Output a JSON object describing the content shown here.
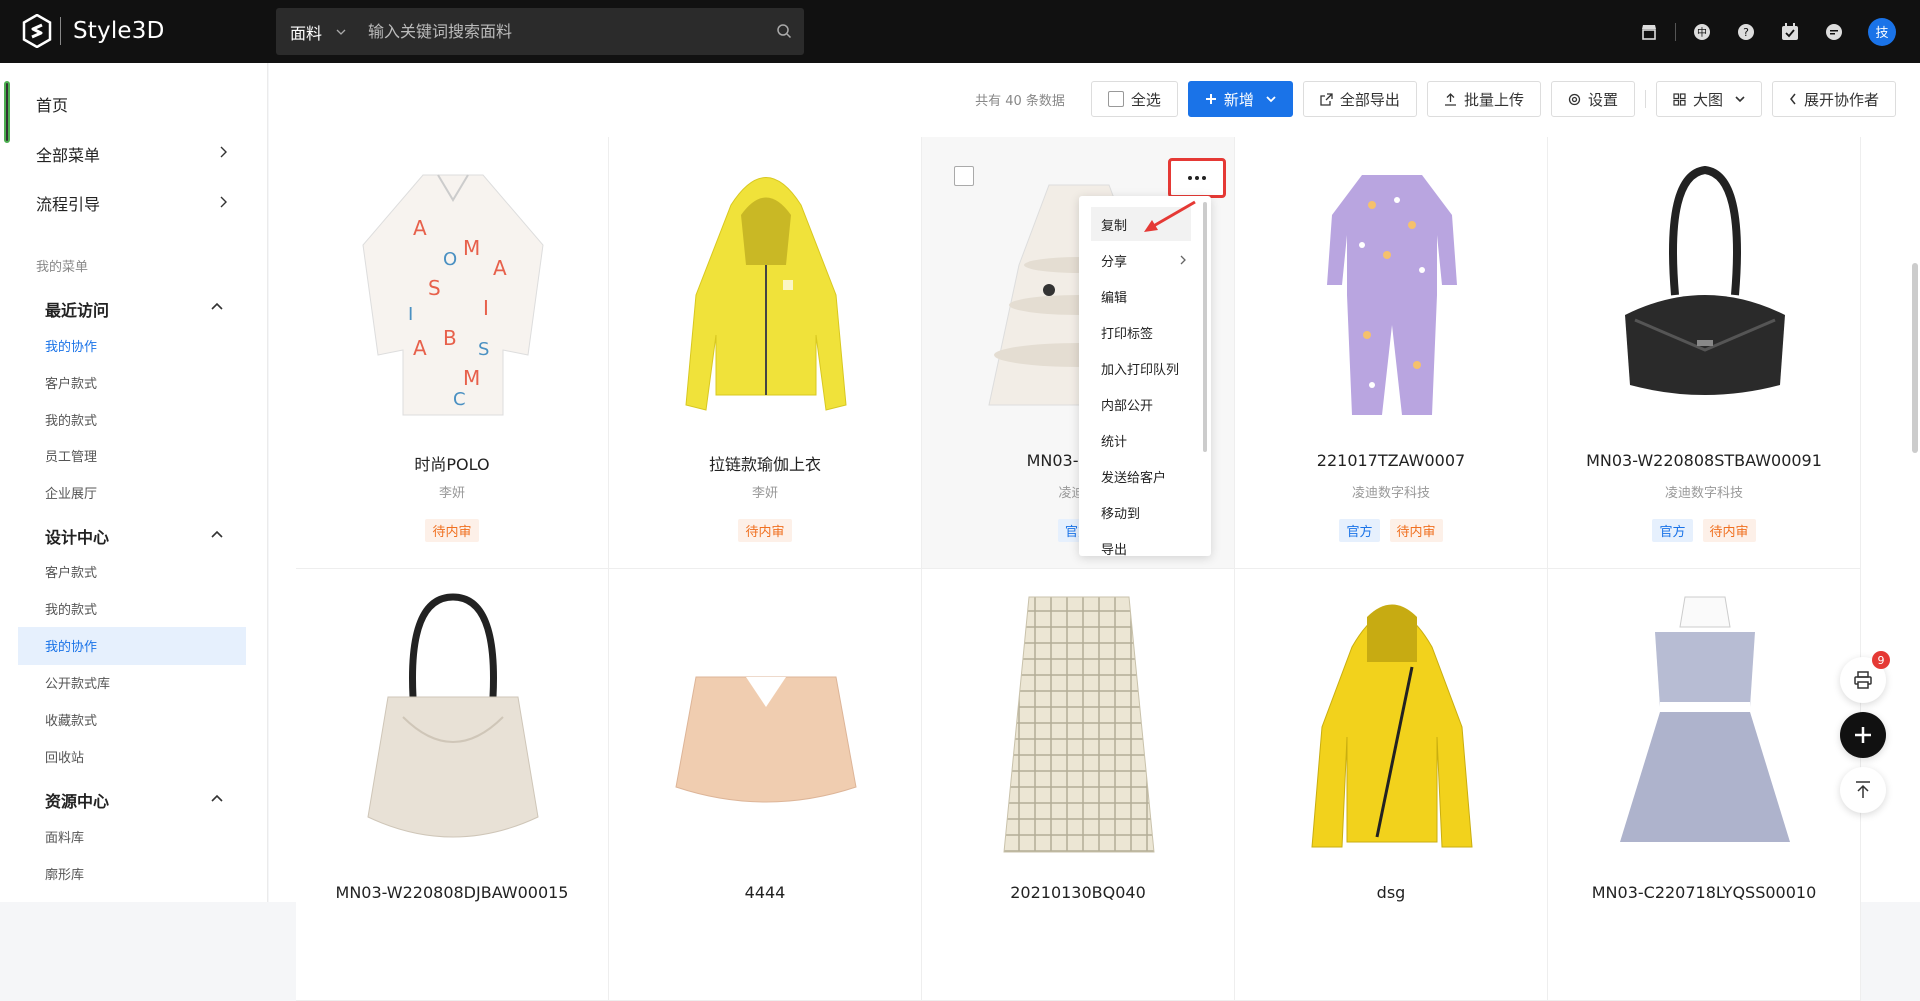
{
  "topbar": {
    "logo_text": "Style3D",
    "search_category": "面料",
    "search_placeholder": "输入关键词搜索面料",
    "avatar_text": "技"
  },
  "sidebar": {
    "top_items": [
      {
        "label": "首页"
      },
      {
        "label": "全部菜单"
      },
      {
        "label": "流程引导"
      }
    ],
    "section_title": "我的菜单",
    "groups": [
      {
        "title": "最近访问",
        "items": [
          "我的协作",
          "客户款式",
          "我的款式",
          "员工管理",
          "企业展厅"
        ]
      },
      {
        "title": "设计中心",
        "items": [
          "客户款式",
          "我的款式",
          "我的协作",
          "公开款式库",
          "收藏款式",
          "回收站"
        ]
      },
      {
        "title": "资源中心",
        "items": [
          "面料库",
          "廓形库"
        ]
      }
    ]
  },
  "toolbar": {
    "total": "共有 40 条数据",
    "select_all": "全选",
    "add": "新增",
    "export_all": "全部导出",
    "batch_upload": "批量上传",
    "settings": "设置",
    "view": "大图",
    "expand": "展开协作者"
  },
  "cards": [
    {
      "title": "时尚POLO",
      "sub": "李妍",
      "tags": [
        {
          "text": "待内审",
          "kind": "pending"
        }
      ]
    },
    {
      "title": "拉链款瑜伽上衣",
      "sub": "李妍",
      "tags": [
        {
          "text": "待内审",
          "kind": "pending"
        }
      ]
    },
    {
      "title": "MN03-22093",
      "sub": "凌迪数",
      "tags": [
        {
          "text": "官方",
          "kind": "official"
        }
      ]
    },
    {
      "title": "221017TZAW0007",
      "sub": "凌迪数字科技",
      "tags": [
        {
          "text": "官方",
          "kind": "official"
        },
        {
          "text": "待内审",
          "kind": "pending"
        }
      ]
    },
    {
      "title": "MN03-W220808STBAW00091",
      "sub": "凌迪数字科技",
      "tags": [
        {
          "text": "官方",
          "kind": "official"
        },
        {
          "text": "待内审",
          "kind": "pending"
        }
      ]
    },
    {
      "title": "MN03-W220808DJBAW00015",
      "sub": "",
      "tags": []
    },
    {
      "title": "4444",
      "sub": "",
      "tags": []
    },
    {
      "title": "20210130BQ040",
      "sub": "",
      "tags": []
    },
    {
      "title": "dsg",
      "sub": "",
      "tags": []
    },
    {
      "title": "MN03-C220718LYQSS00010",
      "sub": "",
      "tags": []
    }
  ],
  "context_menu": {
    "items": [
      "复制",
      "分享",
      "编辑",
      "打印标签",
      "加入打印队列",
      "内部公开",
      "统计",
      "发送给客户",
      "移动到",
      "导出"
    ]
  },
  "float": {
    "print_badge": "9"
  },
  "colors": {
    "accent": "#1a73e8",
    "highlight": "#e53935",
    "pending": "#f07020"
  }
}
